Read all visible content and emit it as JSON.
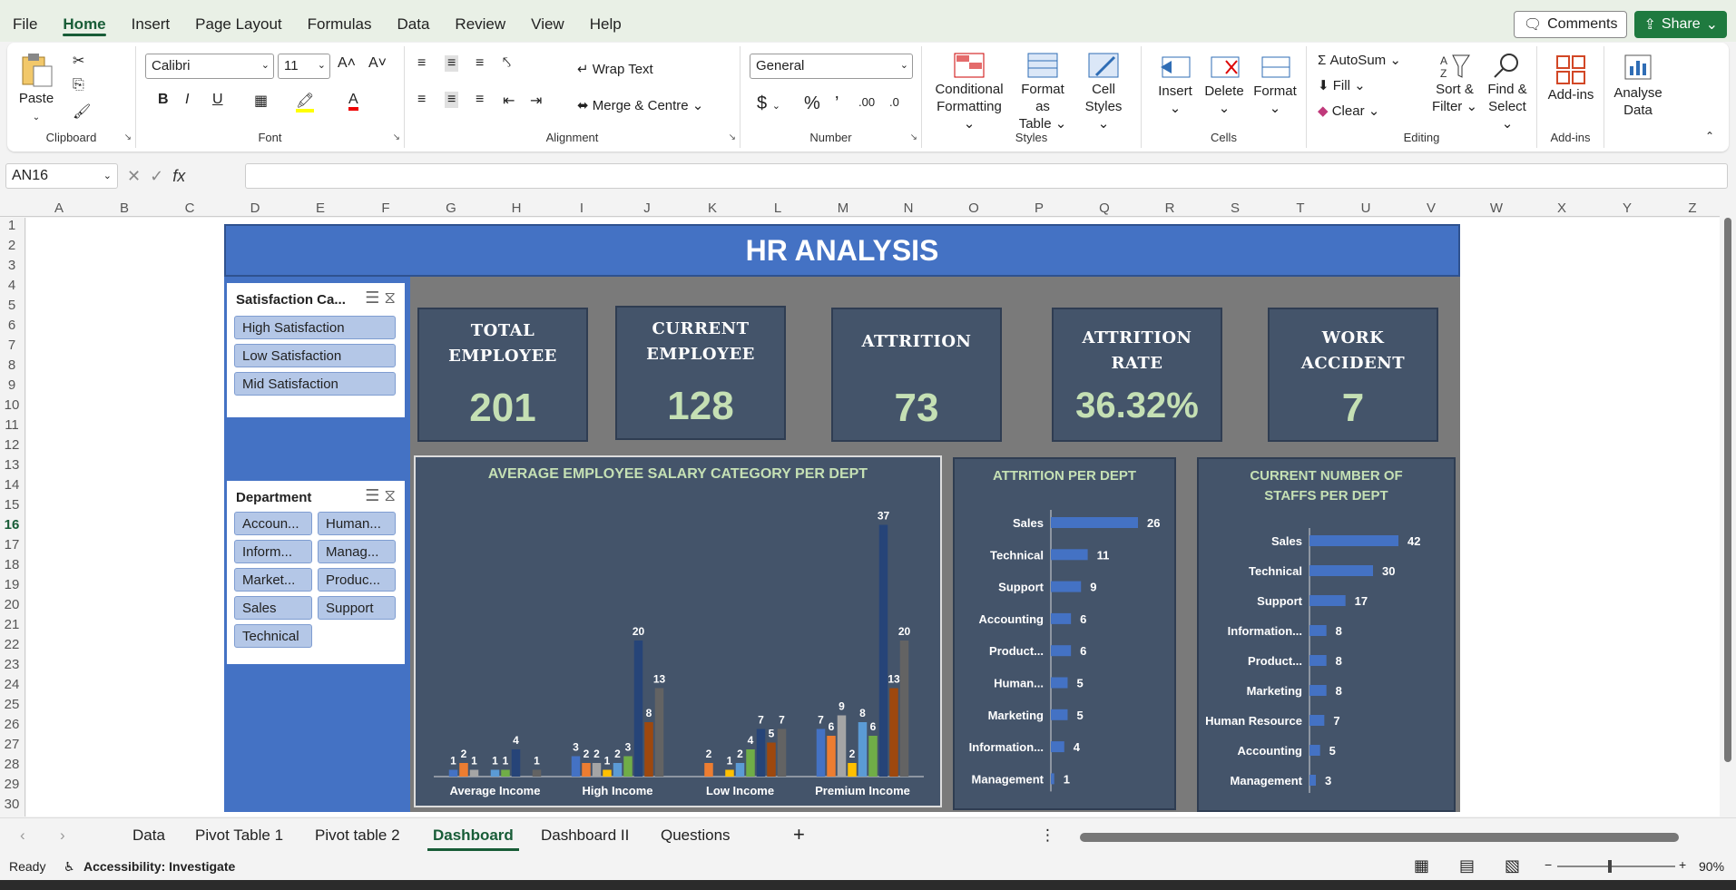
{
  "menu": [
    "File",
    "Home",
    "Insert",
    "Page Layout",
    "Formulas",
    "Data",
    "Review",
    "View",
    "Help"
  ],
  "menu_active": "Home",
  "top_buttons": {
    "comments": "Comments",
    "share": "Share"
  },
  "ribbon": {
    "clipboard": {
      "paste": "Paste",
      "label": "Clipboard"
    },
    "font": {
      "name": "Calibri",
      "size": "11",
      "label": "Font"
    },
    "alignment": {
      "wrap": "Wrap Text",
      "merge": "Merge & Centre",
      "label": "Alignment"
    },
    "number": {
      "format": "General",
      "label": "Number"
    },
    "styles": {
      "conditional": "Conditional",
      "conditional2": "Formatting",
      "format_table": "Format as",
      "format_table2": "Table",
      "cell_styles": "Cell",
      "cell_styles2": "Styles",
      "label": "Styles"
    },
    "cells": {
      "insert": "Insert",
      "delete": "Delete",
      "format": "Format",
      "label": "Cells"
    },
    "editing": {
      "autosum": "AutoSum",
      "fill": "Fill",
      "clear": "Clear",
      "sort": "Sort &",
      "sort2": "Filter",
      "find": "Find &",
      "find2": "Select",
      "label": "Editing"
    },
    "addins": {
      "addins": "Add-ins",
      "label": "Add-ins"
    },
    "analyse": {
      "line1": "Analyse",
      "line2": "Data"
    }
  },
  "formula_bar": {
    "name_box": "AN16",
    "fx": "fx",
    "formula": ""
  },
  "columns": [
    "A",
    "B",
    "C",
    "D",
    "E",
    "F",
    "G",
    "H",
    "I",
    "J",
    "K",
    "L",
    "M",
    "N",
    "O",
    "P",
    "Q",
    "R",
    "S",
    "T",
    "U",
    "V",
    "W",
    "X",
    "Y",
    "Z"
  ],
  "rows": [
    "1",
    "2",
    "3",
    "4",
    "5",
    "6",
    "7",
    "8",
    "9",
    "10",
    "11",
    "12",
    "13",
    "14",
    "15",
    "16",
    "17",
    "18",
    "19",
    "20",
    "21",
    "22",
    "23",
    "24",
    "25",
    "26",
    "27",
    "28",
    "29",
    "30"
  ],
  "dashboard": {
    "title": "HR ANALYSIS",
    "slicer_satisfaction": {
      "title": "Satisfaction Ca...",
      "items": [
        "High Satisfaction",
        "Low Satisfaction",
        "Mid Satisfaction"
      ]
    },
    "slicer_department": {
      "title": "Department",
      "items": [
        "Accoun...",
        "Human...",
        "Inform...",
        "Manag...",
        "Market...",
        "Produc...",
        "Sales",
        "Support",
        "Technical"
      ]
    },
    "kpis": [
      {
        "line1": "TOTAL",
        "line2": "EMPLOYEE",
        "value": "201"
      },
      {
        "line1": "CURRENT",
        "line2": "EMPLOYEE",
        "value": "128"
      },
      {
        "line1": "ATTRITION",
        "line2": "",
        "value": "73"
      },
      {
        "line1": "ATTRITION",
        "line2": "RATE",
        "value": "36.32%"
      },
      {
        "line1": "WORK ACCIDENT",
        "line2": "",
        "value": "7"
      }
    ]
  },
  "chart_data": [
    {
      "type": "bar",
      "title": "AVERAGE EMPLOYEE SALARY CATEGORY PER DEPT",
      "categories": [
        "Average Income",
        "High Income",
        "Low Income",
        "Premium Income"
      ],
      "series_colors": [
        "#4472c4",
        "#ed7d31",
        "#a5a5a5",
        "#ffc000",
        "#5b9bd5",
        "#70ad47",
        "#264478",
        "#9e480e",
        "#636363"
      ],
      "groups": [
        [
          1,
          2,
          1,
          null,
          1,
          1,
          4,
          null,
          1
        ],
        [
          3,
          2,
          2,
          1,
          2,
          3,
          20,
          8,
          13
        ],
        [
          null,
          2,
          null,
          1,
          2,
          4,
          7,
          5,
          7
        ],
        [
          7,
          6,
          9,
          2,
          8,
          6,
          37,
          13,
          20
        ]
      ],
      "ylim": [
        0,
        40
      ]
    },
    {
      "type": "bar",
      "orientation": "horizontal",
      "title": "ATTRITION PER DEPT",
      "categories": [
        "Sales",
        "Technical",
        "Support",
        "Accounting",
        "Product...",
        "Human...",
        "Marketing",
        "Information...",
        "Management"
      ],
      "values": [
        26,
        11,
        9,
        6,
        6,
        5,
        5,
        4,
        1
      ],
      "color": "#4472c4"
    },
    {
      "type": "bar",
      "orientation": "horizontal",
      "title": "CURRENT NUMBER OF STAFFS PER DEPT",
      "title_line1": "CURRENT NUMBER OF",
      "title_line2": "STAFFS PER DEPT",
      "categories": [
        "Sales",
        "Technical",
        "Support",
        "Information...",
        "Product...",
        "Marketing",
        "Human Resource",
        "Accounting",
        "Management"
      ],
      "values": [
        42,
        30,
        17,
        8,
        8,
        8,
        7,
        5,
        3
      ],
      "color": "#4472c4"
    }
  ],
  "sheet_tabs": [
    "Data",
    "Pivot Table 1",
    "Pivot table 2",
    "Dashboard",
    "Dashboard II",
    "Questions"
  ],
  "active_tab": "Dashboard",
  "status": {
    "ready": "Ready",
    "accessibility": "Accessibility: Investigate",
    "zoom": "90%"
  }
}
